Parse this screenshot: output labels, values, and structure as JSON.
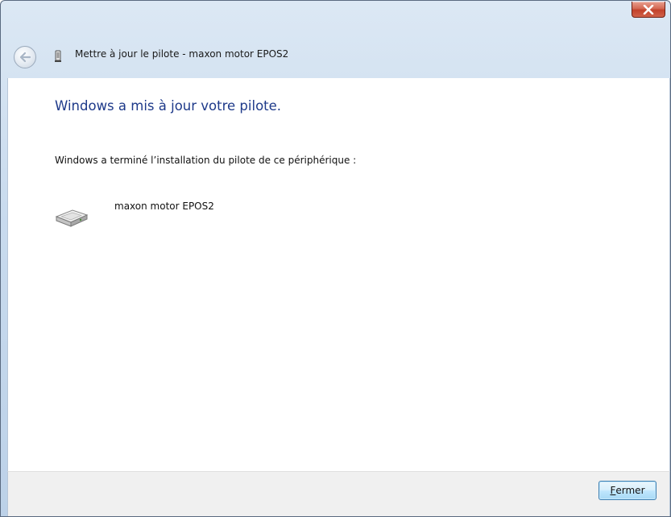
{
  "window": {
    "title": "Mettre à jour le pilote - maxon motor EPOS2"
  },
  "main": {
    "heading": "Windows a mis à jour votre pilote.",
    "message": "Windows a terminé l’installation du pilote de ce périphérique :",
    "device_name": "maxon motor EPOS2"
  },
  "footer": {
    "close_label_mnemonic": "F",
    "close_label_rest": "ermer"
  },
  "icons": {
    "back": "back-arrow-icon",
    "title_device": "usb-device-icon",
    "device": "drive-device-icon",
    "close": "close-x-icon"
  },
  "colors": {
    "heading": "#1e3a8a",
    "close_button": "#c2412a",
    "footer_bg": "#f0f0f0"
  }
}
